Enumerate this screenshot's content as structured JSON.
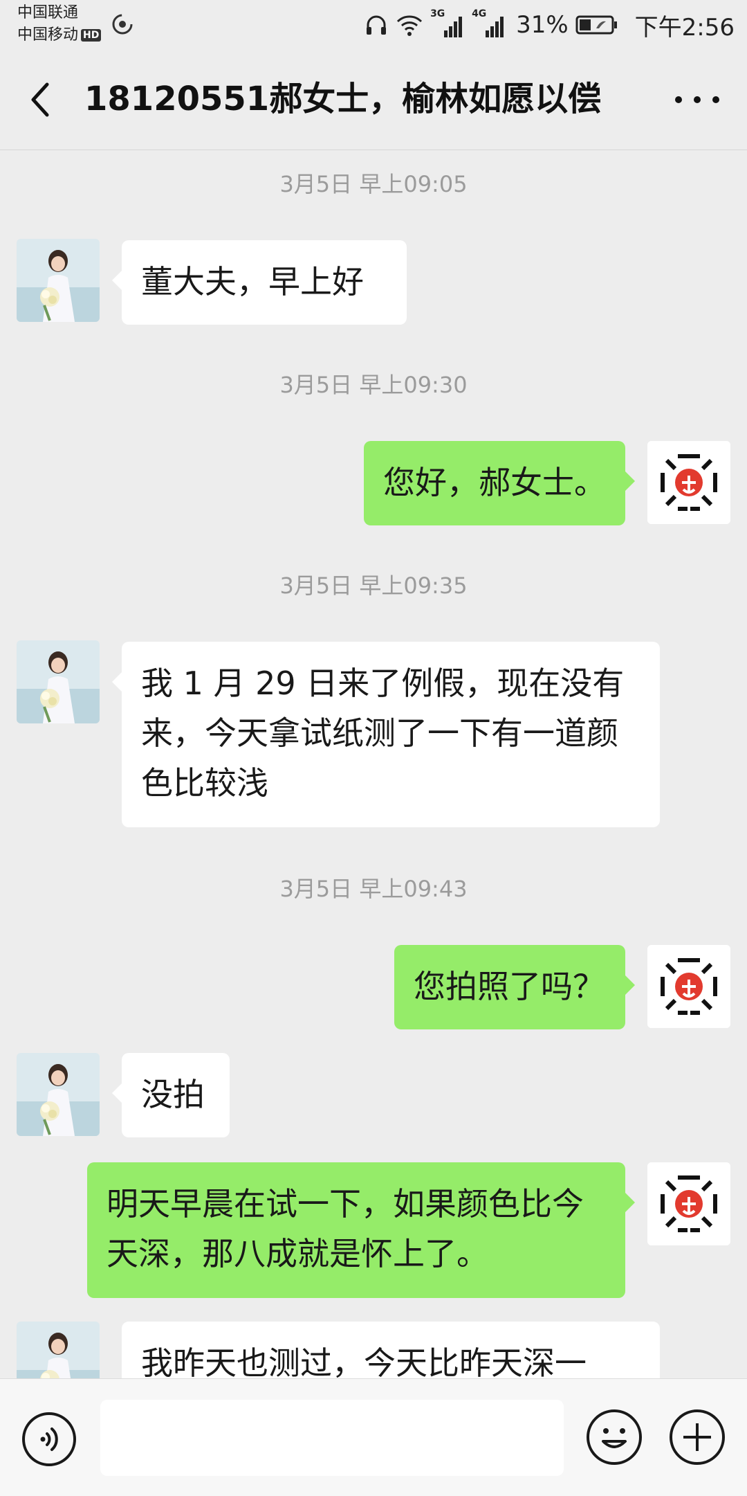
{
  "status_bar": {
    "carrier_1": "中国联通",
    "carrier_2": "中国移动",
    "hd_badge": "HD",
    "network_1": "3G",
    "network_2": "4G",
    "battery": "31%",
    "time": "下午2:56"
  },
  "header": {
    "title": "18120551郝女士，榆林如愿以偿"
  },
  "messages": [
    {
      "type": "timestamp",
      "text": "3月5日 早上09:05"
    },
    {
      "type": "in",
      "text": "董大夫，早上好"
    },
    {
      "type": "timestamp",
      "text": "3月5日 早上09:30"
    },
    {
      "type": "out",
      "text": "您好，郝女士。"
    },
    {
      "type": "timestamp",
      "text": "3月5日 早上09:35"
    },
    {
      "type": "in",
      "text": "我 1 月 29 日来了例假，现在没有来，今天拿试纸测了一下有一道颜色比较浅"
    },
    {
      "type": "timestamp",
      "text": "3月5日 早上09:43"
    },
    {
      "type": "out",
      "text": "您拍照了吗？"
    },
    {
      "type": "in",
      "text": "没拍"
    },
    {
      "type": "out",
      "text": "明天早晨在试一下，如果颜色比今天深，那八成就是怀上了。"
    },
    {
      "type": "in",
      "text": "我昨天也测过，今天比昨天深一"
    }
  ],
  "input_bar": {
    "placeholder": ""
  },
  "colors": {
    "background": "#ededed",
    "outgoing_bubble": "#95ec69",
    "incoming_bubble": "#ffffff",
    "timestamp_text": "#9b9b9b"
  }
}
